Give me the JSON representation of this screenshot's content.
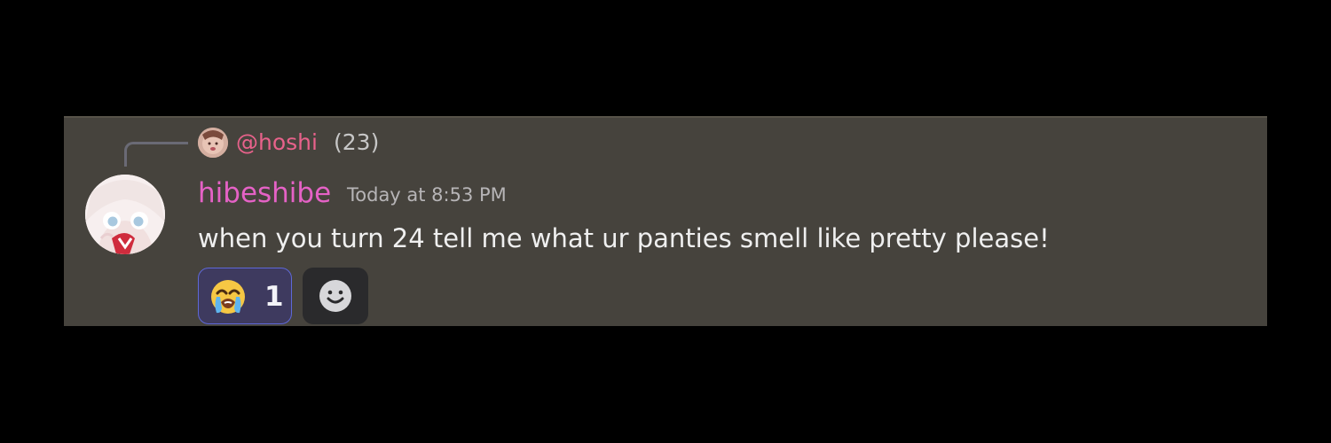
{
  "reply": {
    "username": "@hoshi",
    "meta": "(23)",
    "avatar_icon": "reply-avatar-icon"
  },
  "message": {
    "username": "hibeshibe",
    "timestamp": "Today at 8:53 PM",
    "text": "when you turn 24 tell me what ur panties smell like pretty please!",
    "avatar_icon": "user-avatar-icon"
  },
  "reactions": {
    "items": [
      {
        "emoji": "loudly-crying-face-emoji",
        "count": "1"
      }
    ],
    "add_reaction_icon": "add-reaction-icon"
  },
  "colors": {
    "page_background": "#000000",
    "message_background": "#46433d",
    "reply_username": "#e8628b",
    "username": "#e562c6",
    "timestamp": "#b7b5b7",
    "message_text": "#efefef",
    "reaction_border": "#5e68d8",
    "reaction_background": "#3e3a5f",
    "add_reaction_background": "#2a2a2c"
  }
}
